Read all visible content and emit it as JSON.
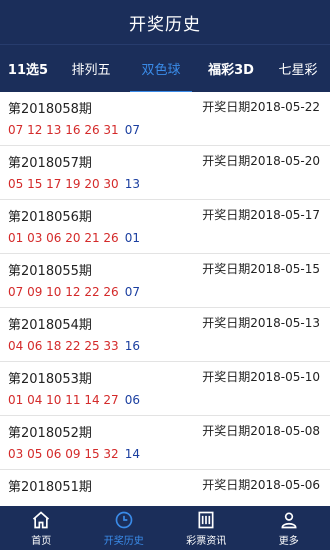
{
  "header": {
    "title": "开奖历史"
  },
  "tabs": [
    {
      "label": "11选5"
    },
    {
      "label": "排列五"
    },
    {
      "label": "双色球"
    },
    {
      "label": "福彩3D"
    },
    {
      "label": "七星彩"
    }
  ],
  "active_tab": "双色球",
  "results": [
    {
      "issue": "第2018058期",
      "date": "开奖日期2018-05-22",
      "red": "07 12 13 16 26 31",
      "blue": "07"
    },
    {
      "issue": "第2018057期",
      "date": "开奖日期2018-05-20",
      "red": "05 15 17 19 20 30",
      "blue": "13"
    },
    {
      "issue": "第2018056期",
      "date": "开奖日期2018-05-17",
      "red": "01 03 06 20 21 26",
      "blue": "01"
    },
    {
      "issue": "第2018055期",
      "date": "开奖日期2018-05-15",
      "red": "07 09 10 12 22 26",
      "blue": "07"
    },
    {
      "issue": "第2018054期",
      "date": "开奖日期2018-05-13",
      "red": "04 06 18 22 25 33",
      "blue": "16"
    },
    {
      "issue": "第2018053期",
      "date": "开奖日期2018-05-10",
      "red": "01 04 10 11 14 27",
      "blue": "06"
    },
    {
      "issue": "第2018052期",
      "date": "开奖日期2018-05-08",
      "red": "03 05 06 09 15 32",
      "blue": "14"
    },
    {
      "issue": "第2018051期",
      "date": "开奖日期2018-05-06",
      "red": "",
      "blue": ""
    }
  ],
  "bottom_nav": [
    {
      "label": "首页",
      "icon": "home-icon"
    },
    {
      "label": "开奖历史",
      "icon": "clock-icon"
    },
    {
      "label": "彩票资讯",
      "icon": "news-icon"
    },
    {
      "label": "更多",
      "icon": "user-icon"
    }
  ],
  "colors": {
    "header_bg": "#1b2e5a",
    "accent": "#3a8be8",
    "red_ball": "#d42a2a",
    "blue_ball": "#1b3fa0"
  }
}
